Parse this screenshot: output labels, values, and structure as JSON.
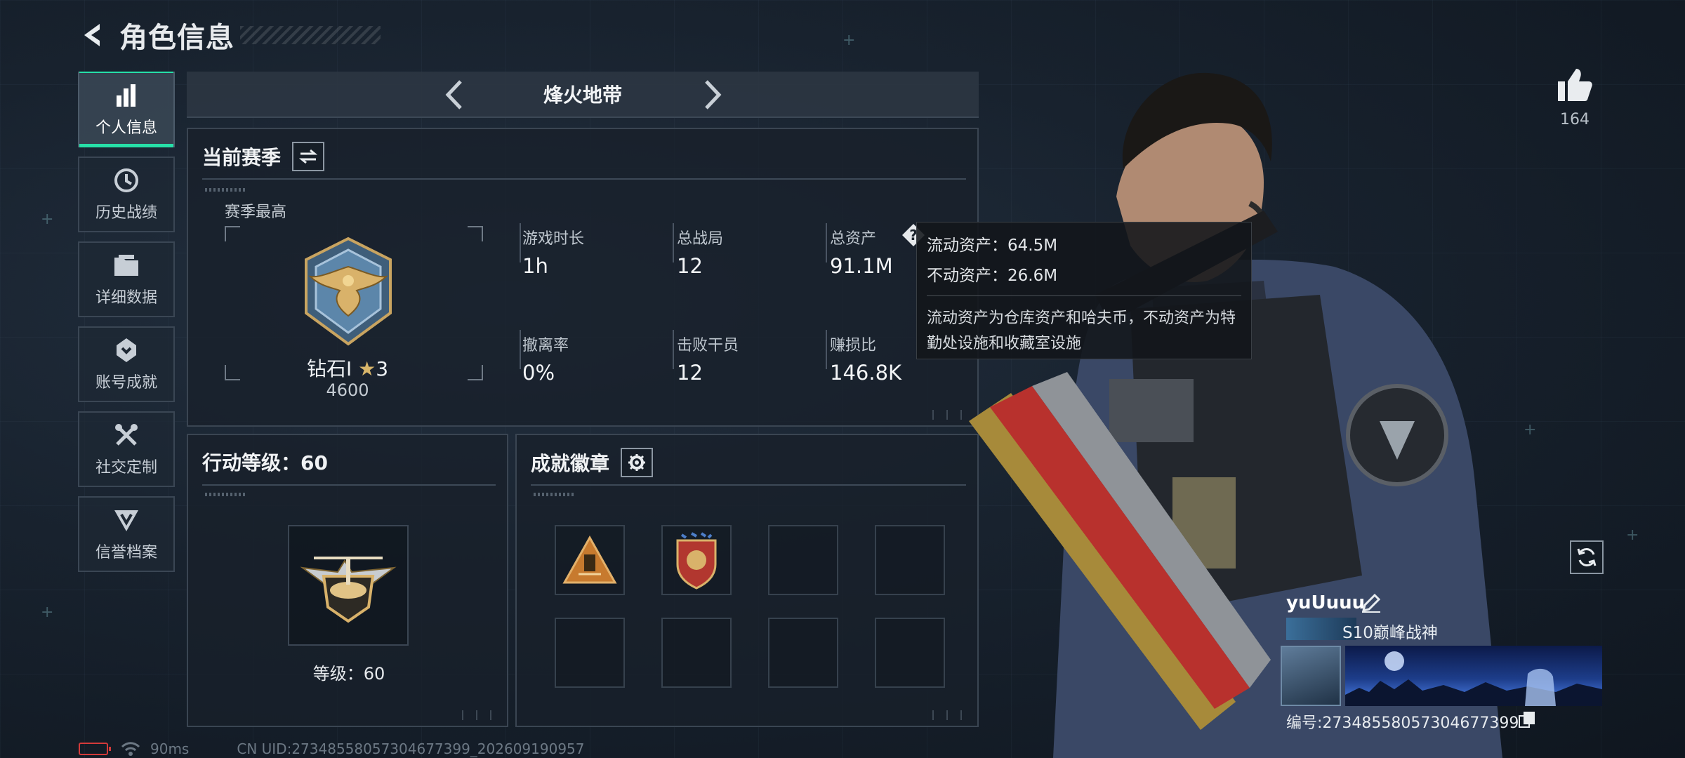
{
  "header": {
    "title": "角色信息"
  },
  "nav": {
    "items": [
      {
        "label": "个人信息",
        "icon": "bar-chart-icon",
        "active": true
      },
      {
        "label": "历史战绩",
        "icon": "history-icon",
        "active": false
      },
      {
        "label": "详细数据",
        "icon": "folder-icon",
        "active": false
      },
      {
        "label": "账号成就",
        "icon": "achievement-icon",
        "active": false
      },
      {
        "label": "社交定制",
        "icon": "tools-icon",
        "active": false
      },
      {
        "label": "信誉档案",
        "icon": "reputation-icon",
        "active": false
      }
    ]
  },
  "mode": {
    "title": "烽火地带"
  },
  "season": {
    "title": "当前赛季",
    "best_label": "赛季最高",
    "rank_name": "钻石I",
    "rank_stars": "3",
    "rank_score": "4600",
    "stats": [
      {
        "label": "游戏时长",
        "value": "1h"
      },
      {
        "label": "总战局",
        "value": "12"
      },
      {
        "label": "总资产",
        "value": "91.1M"
      },
      {
        "label": "撤离率",
        "value": "0%"
      },
      {
        "label": "击败干员",
        "value": "12"
      },
      {
        "label": "赚损比",
        "value": "146.8K"
      }
    ]
  },
  "tooltip": {
    "liquid": "流动资产：64.5M",
    "fixed": "不动资产：26.6M",
    "description": "流动资产为仓库资产和哈夫币，不动资产为特勤处设施和收藏室设施"
  },
  "action_level": {
    "title": "行动等级：60",
    "level_text": "等级：60"
  },
  "achievements": {
    "title": "成就徽章"
  },
  "likes": {
    "count": "164"
  },
  "profile": {
    "name": "yuUuuu",
    "title": "S10巅峰战神",
    "id": "编号:27348558057304677399"
  },
  "status": {
    "ping": "90ms",
    "uid": "CN UID:27348558057304677399_202609190957"
  },
  "colors": {
    "accent": "#27e0a8",
    "panel_border": "#3a4552"
  }
}
